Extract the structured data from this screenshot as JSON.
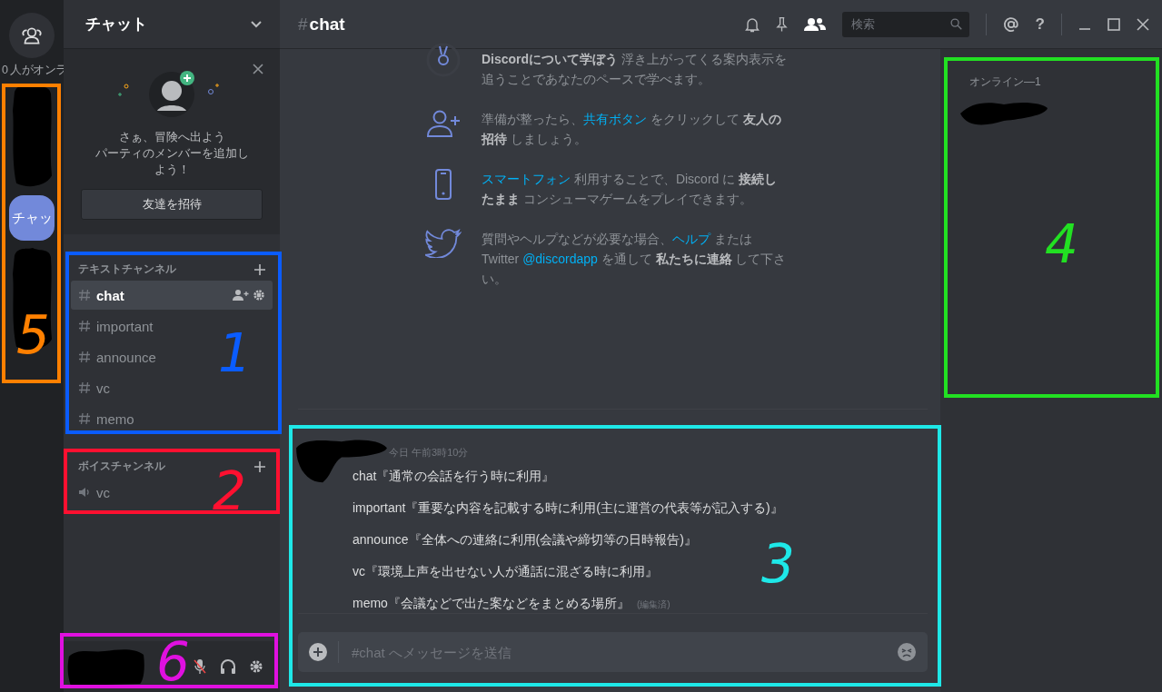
{
  "servers": {
    "online_text": "0 人がオンラ",
    "items": [
      {
        "kind": "redacted"
      },
      {
        "kind": "server",
        "label": "チャッ",
        "selected": true
      },
      {
        "kind": "redacted"
      }
    ]
  },
  "sidebar": {
    "title": "チャット",
    "invite_card": {
      "lines": [
        "さぁ、冒険へ出よう",
        "パーティのメンバーを追加しよう！"
      ],
      "button": "友達を招待"
    },
    "categories": [
      {
        "name": "テキストチャンネル",
        "kind": "text",
        "channels": [
          {
            "name": "chat",
            "selected": true
          },
          {
            "name": "important",
            "selected": false
          },
          {
            "name": "announce",
            "selected": false
          },
          {
            "name": "vc",
            "selected": false
          },
          {
            "name": "memo",
            "selected": false
          }
        ]
      },
      {
        "name": "ボイスチャンネル",
        "kind": "voice",
        "channels": [
          {
            "name": "vc",
            "selected": false
          }
        ]
      }
    ],
    "user_panel": {
      "kind": "redacted",
      "mic_muted": true
    }
  },
  "header": {
    "hash": "#",
    "channel": "chat",
    "search": {
      "placeholder": "検索"
    },
    "help": "?"
  },
  "tips": [
    [
      {
        "text": "Discordについて学ぼう",
        "bold": true
      },
      {
        "text": " 浮き上がってくる案内表示を追うことであなたのペースで学べます。"
      }
    ],
    [
      {
        "text": "準備が整ったら、"
      },
      {
        "text": "共有ボタン",
        "link": true
      },
      {
        "text": " をクリックして "
      },
      {
        "text": "友人の招待",
        "bold": true
      },
      {
        "text": " しましょう。"
      }
    ],
    [
      {
        "text": "スマートフォン",
        "link": true
      },
      {
        "text": " 利用することで、Discord に "
      },
      {
        "text": "接続したまま",
        "bold": true
      },
      {
        "text": " コンシューマゲームをプレイできます。"
      }
    ],
    [
      {
        "text": "質問やヘルプなどが必要な場合、"
      },
      {
        "text": "ヘルプ",
        "link": true
      },
      {
        "text": " または Twitter "
      },
      {
        "text": "@discordapp",
        "link": true
      },
      {
        "text": " を通して "
      },
      {
        "text": "私たちに連絡",
        "bold": true
      },
      {
        "text": " して下さい。"
      }
    ]
  ],
  "message": {
    "author": {
      "kind": "redacted"
    },
    "time": "今日 午前3時10分",
    "lines": [
      {
        "text": "chat『通常の会話を行う時に利用』"
      },
      {
        "text": "important『重要な内容を記載する時に利用(主に運営の代表等が記入する)』"
      },
      {
        "text": "announce『全体への連絡に利用(会議や締切等の日時報告)』"
      },
      {
        "text": "vc『環境上声を出せない人が通話に混ざる時に利用』"
      },
      {
        "text": "memo『会議などで出た案などをまとめる場所』",
        "edited": "(編集済)"
      }
    ]
  },
  "composer": {
    "placeholder": "#chat へメッセージを送信"
  },
  "members": {
    "heading": "オンライン—1",
    "items": [
      {
        "kind": "redacted"
      }
    ]
  },
  "annotations": [
    {
      "label": "5",
      "color": "#ff8000"
    },
    {
      "label": "1",
      "color": "#0a5cff"
    },
    {
      "label": "2",
      "color": "#ff1030"
    },
    {
      "label": "3",
      "color": "#1ee8e8"
    },
    {
      "label": "4",
      "color": "#22e022"
    },
    {
      "label": "6",
      "color": "#e010e0"
    }
  ]
}
